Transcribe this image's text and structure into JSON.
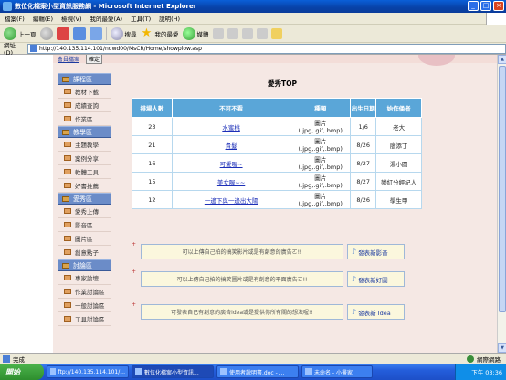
{
  "window": {
    "title": "數位化檔案小型資訊服務網 - Microsoft Internet Explorer"
  },
  "menu": [
    "檔案(F)",
    "編輯(E)",
    "檢視(V)",
    "我的最愛(A)",
    "工具(T)",
    "說明(H)"
  ],
  "toolbar": {
    "back": "上一頁",
    "search": "搜尋",
    "favorites": "我的最愛",
    "media": "媒體"
  },
  "address": {
    "label": "網址(D)",
    "url": "http://140.135.114.101/ndwd00/MsCR/Home/showplow.asp"
  },
  "banner": {
    "link": "會員檔案",
    "button": "確定"
  },
  "sidebar": {
    "sections": [
      {
        "title": "課程區",
        "items": [
          "教材下載",
          "成績查詢",
          "作業區"
        ]
      },
      {
        "title": "教學區",
        "items": [
          "主題教學",
          "案例分享",
          "軟體工具",
          "好書推薦"
        ]
      },
      {
        "title": "愛秀區",
        "items": [
          "愛秀上傳",
          "影音區",
          "圖片區",
          "創意點子"
        ]
      },
      {
        "title": "討論區",
        "items": [
          "專家論壇",
          "作業討論區",
          "一般討論區",
          "工具討論區"
        ]
      }
    ]
  },
  "main": {
    "title": "愛秀TOP",
    "table": {
      "headers": [
        "排場人數",
        "不可不看",
        "種類",
        "出生日期",
        "始作俑者"
      ],
      "rows": [
        {
          "count": "23",
          "title": "水蜜桃",
          "type": "圖片\n(.jpg,.gif,.bmp)",
          "date": "1/6",
          "author": "老大"
        },
        {
          "count": "21",
          "title": "貴髮",
          "type": "圖片\n(.jpg,.gif,.bmp)",
          "date": "8/26",
          "author": "廖添丁"
        },
        {
          "count": "16",
          "title": "可愛喔~",
          "type": "圖片\n(.jpg,.gif,.bmp)",
          "date": "8/27",
          "author": "湯小圓"
        },
        {
          "count": "15",
          "title": "美女喔~~",
          "type": "圖片\n(.jpg,.gif,.bmp)",
          "date": "8/27",
          "author": "戀紅分經紀人"
        },
        {
          "count": "12",
          "title": "一邊下與一邊出大陽",
          "type": "圖片\n(.jpg,.gif,.bmp)",
          "date": "8/26",
          "author": "學生甲"
        }
      ]
    },
    "shares": [
      {
        "text": "可以上傳自己拍的搞笑影片或是有創意的廣告ㄛ!!",
        "button": "發表新影音"
      },
      {
        "text": "可以上傳自己拍的搞笑圖片或是有創意的平面廣告ㄛ!!",
        "button": "發表新好圖"
      },
      {
        "text": "可發表自己有創意的廣告idea或是提供你所有關的想法喔!!",
        "button": "發表新 Idea"
      }
    ]
  },
  "status": {
    "text": "完成",
    "zone": "網際網路"
  },
  "taskbar": {
    "start": "開始",
    "tasks": [
      "ftp://140.135.114.101/...",
      "數位化檔案小型資訊...",
      "使用者說明書.doc - ...",
      "未命名 - 小畫家"
    ],
    "clock": "下午 03:36"
  },
  "colors": {
    "accent": "#5aa6d8",
    "sidebar_header": "#6b8cc8",
    "page_bg": "#f5e8e4"
  }
}
